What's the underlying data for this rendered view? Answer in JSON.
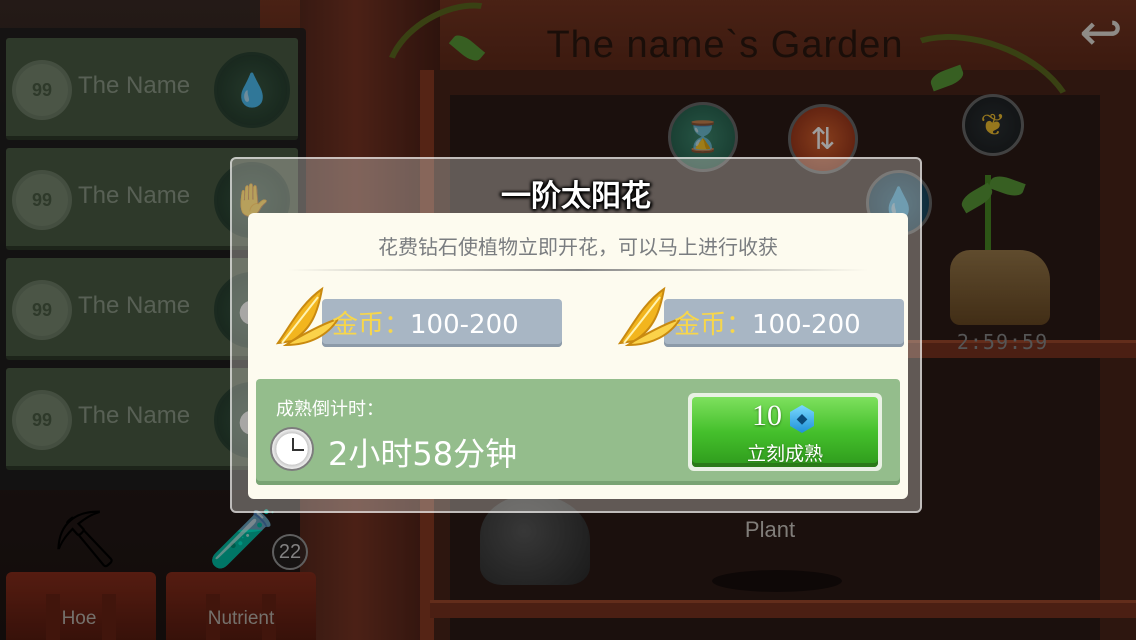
{
  "garden": {
    "title": "The name`s Garden",
    "back_icon": "back-arrow-icon",
    "plant_timer": "2:59:59",
    "plant_label": "Plant",
    "action_icons": [
      "hourglass-icon",
      "swap-icon",
      "banana-icon",
      "water-drop-icon"
    ]
  },
  "list": {
    "items": [
      {
        "badge": "99",
        "name": "The Name",
        "icon": "water-drop-icon"
      },
      {
        "badge": "99",
        "name": "The Name",
        "icon": "glove-icon"
      },
      {
        "badge": "99",
        "name": "The Name",
        "icon": "item-icon"
      },
      {
        "badge": "99",
        "name": "The Name",
        "icon": "item-icon"
      }
    ]
  },
  "tools": {
    "hoe": {
      "label": "Hoe",
      "icon": "hoe-icon"
    },
    "nutrient": {
      "label": "Nutrient",
      "icon": "nutrient-bottle-icon",
      "count": "22"
    }
  },
  "dialog": {
    "title": "一阶太阳花",
    "description": "花费钻石使植物立即开花，可以马上进行收获",
    "rewards": [
      {
        "label": "金币：",
        "value": "100-200",
        "icon": "gold-leaf-icon"
      },
      {
        "label": "金币：",
        "value": "100-200",
        "icon": "gold-leaf-icon"
      }
    ],
    "timer_caption": "成熟倒计时：",
    "timer_value": "2小时58分钟",
    "timer_icon": "clock-icon",
    "mature_button": {
      "cost": "10",
      "currency_icon": "diamond-icon",
      "label": "立刻成熟"
    }
  },
  "colors": {
    "reward_label": "#f7d64a",
    "timer_panel": "#94bd8c",
    "button_green": "#45c02c",
    "dialog_body": "#fdfbef"
  }
}
